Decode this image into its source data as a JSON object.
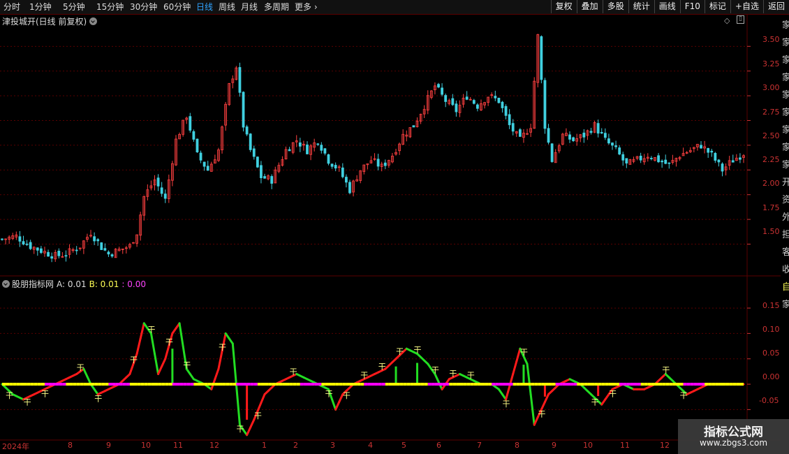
{
  "toolbar": {
    "periods": [
      "分时",
      "1分钟",
      "5分钟",
      "15分钟",
      "30分钟",
      "60分钟",
      "日线",
      "周线",
      "月线",
      "多周期",
      "更多"
    ],
    "active_period": "日线",
    "right_buttons": [
      "复权",
      "叠加",
      "多股",
      "统计",
      "画线",
      "F10",
      "标记",
      "+自选",
      "返回"
    ]
  },
  "main_panel": {
    "title": "津投城开(日线 前复权)",
    "price_ticks": [
      "3.50",
      "3.25",
      "3.00",
      "2.75",
      "2.50",
      "2.25",
      "2.00",
      "1.75",
      "1.50"
    ]
  },
  "indicator_panel": {
    "name": "股朋指标网",
    "a_label": "A: 0.01",
    "b_label": "B: 0.01",
    "c_label": ": 0.00",
    "ticks": [
      "0.15",
      "0.10",
      "0.05",
      "0.00",
      "-0.05"
    ]
  },
  "date_axis": {
    "labels": [
      "2024年",
      "8",
      "9",
      "10",
      "11",
      "12",
      "1",
      "2",
      "3",
      "4",
      "5",
      "6",
      "7",
      "8",
      "9",
      "10",
      "11",
      "12",
      "1"
    ]
  },
  "side_panel": {
    "chars": [
      "家",
      "家",
      "家",
      "家",
      "家",
      "家",
      "家",
      "家",
      "家",
      "开",
      "资",
      "外",
      "担",
      "客",
      "收"
    ],
    "sub_chars": [
      "自",
      "家"
    ]
  },
  "watermark": {
    "main": "指标公式网",
    "sub": "www.zbgs3.com"
  },
  "colors": {
    "up": "#ff4040",
    "down": "#40d0e0",
    "line_red": "#ff1a1a",
    "line_green": "#22dd22",
    "yellow": "#ffff00",
    "magenta": "#ff00ff",
    "grid": "#5a0000",
    "active_tab": "#2fa3ff"
  },
  "chart_data": [
    {
      "type": "candlestick",
      "title": "津投城开(日线 前复权)",
      "ylim": [
        1.2,
        3.7
      ],
      "y_ticks": [
        1.5,
        1.75,
        2.0,
        2.25,
        2.5,
        2.75,
        3.0,
        3.25,
        3.5
      ],
      "x_labels": [
        "2024年",
        "8",
        "9",
        "10",
        "11",
        "12",
        "1",
        "2",
        "3",
        "4",
        "5",
        "6",
        "7",
        "8",
        "9",
        "10",
        "11",
        "12",
        "1"
      ],
      "close_path": [
        [
          0,
          1.55
        ],
        [
          4,
          1.58
        ],
        [
          8,
          1.48
        ],
        [
          12,
          1.42
        ],
        [
          15,
          1.38
        ],
        [
          18,
          1.4
        ],
        [
          22,
          1.48
        ],
        [
          25,
          1.62
        ],
        [
          28,
          1.47
        ],
        [
          30,
          1.4
        ],
        [
          33,
          1.44
        ],
        [
          36,
          1.48
        ],
        [
          38,
          1.62
        ],
        [
          40,
          1.98
        ],
        [
          43,
          2.15
        ],
        [
          46,
          1.95
        ],
        [
          49,
          2.55
        ],
        [
          52,
          2.8
        ],
        [
          55,
          2.4
        ],
        [
          58,
          2.25
        ],
        [
          61,
          2.45
        ],
        [
          64,
          3.1
        ],
        [
          66,
          3.3
        ],
        [
          68,
          2.7
        ],
        [
          70,
          2.45
        ],
        [
          73,
          2.18
        ],
        [
          76,
          2.15
        ],
        [
          80,
          2.45
        ],
        [
          83,
          2.55
        ],
        [
          86,
          2.45
        ],
        [
          89,
          2.55
        ],
        [
          92,
          2.35
        ],
        [
          95,
          2.25
        ],
        [
          98,
          2.05
        ],
        [
          101,
          2.25
        ],
        [
          104,
          2.35
        ],
        [
          107,
          2.28
        ],
        [
          110,
          2.4
        ],
        [
          113,
          2.6
        ],
        [
          116,
          2.7
        ],
        [
          119,
          2.9
        ],
        [
          122,
          3.1
        ],
        [
          125,
          2.95
        ],
        [
          128,
          2.85
        ],
        [
          131,
          3.0
        ],
        [
          134,
          2.9
        ],
        [
          137,
          3.0
        ],
        [
          140,
          2.95
        ],
        [
          143,
          2.7
        ],
        [
          146,
          2.55
        ],
        [
          149,
          2.7
        ],
        [
          151,
          3.6
        ],
        [
          153,
          2.7
        ],
        [
          155,
          2.35
        ],
        [
          158,
          2.6
        ],
        [
          161,
          2.55
        ],
        [
          164,
          2.6
        ],
        [
          167,
          2.7
        ],
        [
          170,
          2.55
        ],
        [
          173,
          2.45
        ],
        [
          176,
          2.3
        ],
        [
          179,
          2.35
        ],
        [
          182,
          2.4
        ],
        [
          185,
          2.35
        ],
        [
          188,
          2.3
        ],
        [
          191,
          2.4
        ],
        [
          194,
          2.45
        ],
        [
          197,
          2.5
        ],
        [
          200,
          2.4
        ],
        [
          203,
          2.25
        ],
        [
          206,
          2.35
        ],
        [
          209,
          2.42
        ]
      ]
    },
    {
      "type": "line",
      "title": "股朋指标网",
      "ylim": [
        -0.11,
        0.19
      ],
      "y_ticks": [
        -0.05,
        0.0,
        0.05,
        0.1,
        0.15
      ],
      "series": [
        {
          "name": "A",
          "points": [
            [
              0,
              0.0
            ],
            [
              3,
              -0.02
            ],
            [
              6,
              -0.03
            ],
            [
              9,
              -0.02
            ],
            [
              12,
              -0.01
            ],
            [
              15,
              0.0
            ],
            [
              18,
              0.01
            ],
            [
              21,
              0.02
            ],
            [
              23,
              0.03
            ],
            [
              25,
              0.0
            ],
            [
              27,
              -0.02
            ],
            [
              30,
              -0.01
            ],
            [
              33,
              0.0
            ],
            [
              36,
              0.02
            ],
            [
              38,
              0.06
            ],
            [
              40,
              0.12
            ],
            [
              42,
              0.1
            ],
            [
              44,
              0.02
            ],
            [
              46,
              0.05
            ],
            [
              48,
              0.1
            ],
            [
              50,
              0.12
            ],
            [
              52,
              0.03
            ],
            [
              54,
              0.01
            ],
            [
              57,
              0.0
            ],
            [
              59,
              -0.01
            ],
            [
              61,
              0.03
            ],
            [
              63,
              0.1
            ],
            [
              65,
              0.08
            ],
            [
              67,
              -0.08
            ],
            [
              69,
              -0.1
            ],
            [
              71,
              -0.07
            ],
            [
              74,
              -0.02
            ],
            [
              77,
              0.0
            ],
            [
              80,
              0.01
            ],
            [
              83,
              0.02
            ],
            [
              86,
              0.01
            ],
            [
              89,
              0.0
            ],
            [
              92,
              -0.01
            ],
            [
              94,
              -0.05
            ],
            [
              96,
              -0.02
            ],
            [
              99,
              0.0
            ],
            [
              102,
              0.01
            ],
            [
              105,
              0.02
            ],
            [
              108,
              0.03
            ],
            [
              111,
              0.05
            ],
            [
              114,
              0.07
            ],
            [
              117,
              0.06
            ],
            [
              120,
              0.04
            ],
            [
              122,
              0.02
            ],
            [
              124,
              -0.01
            ],
            [
              126,
              0.01
            ],
            [
              129,
              0.02
            ],
            [
              132,
              0.01
            ],
            [
              135,
              0.0
            ],
            [
              138,
              0.0
            ],
            [
              140,
              -0.01
            ],
            [
              142,
              -0.03
            ],
            [
              144,
              0.02
            ],
            [
              146,
              0.07
            ],
            [
              148,
              0.04
            ],
            [
              150,
              -0.08
            ],
            [
              152,
              -0.05
            ],
            [
              154,
              -0.02
            ],
            [
              157,
              0.0
            ],
            [
              160,
              0.01
            ],
            [
              163,
              0.0
            ],
            [
              166,
              -0.02
            ],
            [
              169,
              -0.04
            ],
            [
              172,
              -0.01
            ],
            [
              175,
              0.0
            ],
            [
              178,
              -0.01
            ],
            [
              181,
              -0.01
            ],
            [
              184,
              0.0
            ],
            [
              187,
              0.02
            ],
            [
              190,
              0.0
            ],
            [
              193,
              -0.02
            ],
            [
              196,
              -0.01
            ],
            [
              199,
              0.0
            ],
            [
              202,
              0.0
            ]
          ]
        }
      ]
    }
  ]
}
